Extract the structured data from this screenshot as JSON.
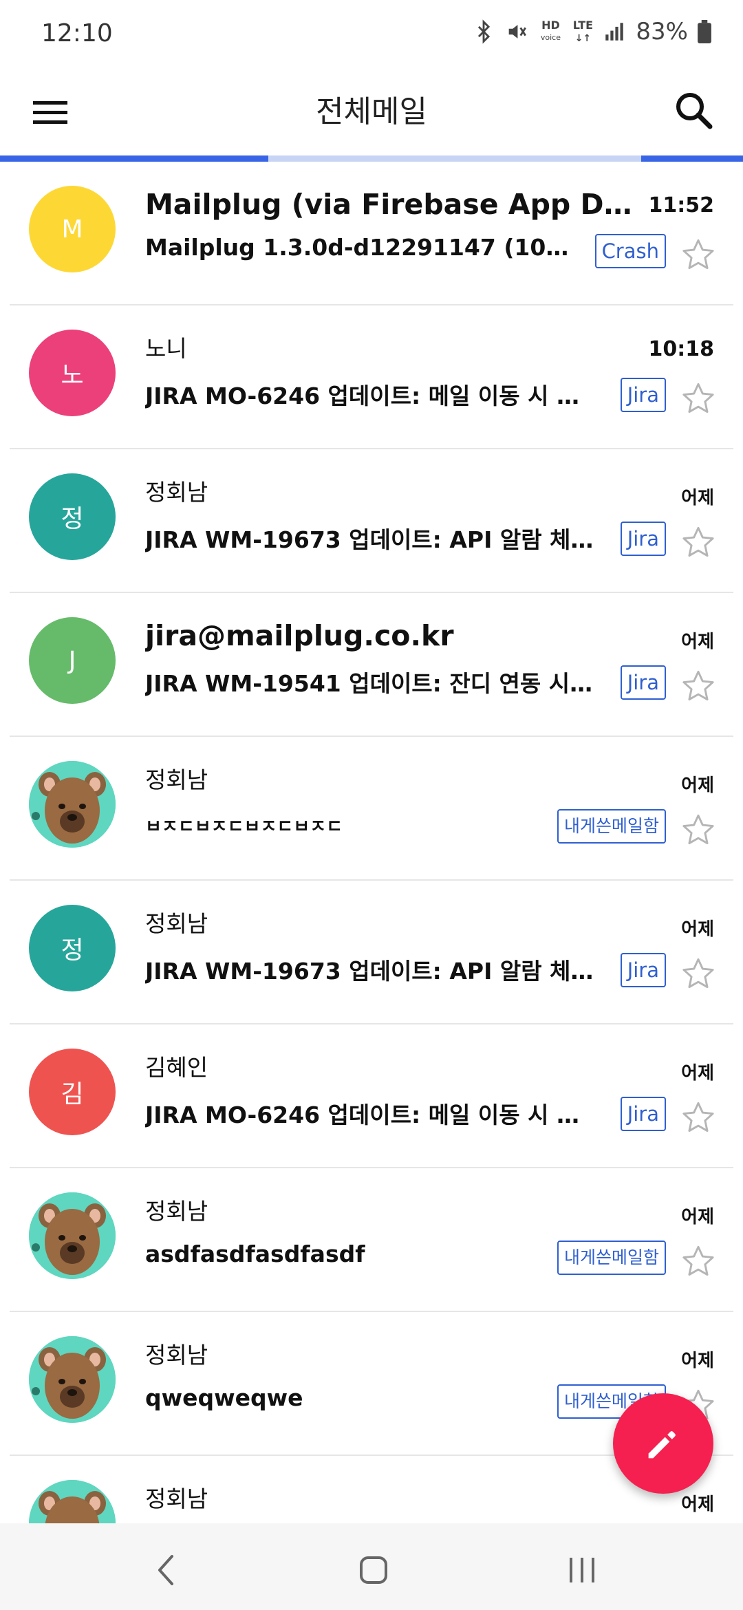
{
  "status_bar": {
    "time": "12:10",
    "battery": "83%",
    "icons": [
      "bluetooth-icon",
      "mute-icon",
      "hd-voice-icon",
      "lte-icon",
      "signal-icon",
      "battery-icon"
    ],
    "hd_label": "HD",
    "lte_label": "LTE"
  },
  "app_bar": {
    "title": "전체메일",
    "menu_icon": "hamburger-menu-icon",
    "search_icon": "search-icon"
  },
  "colors": {
    "accent": "#3864e6",
    "fab": "#f5204f",
    "tag_border": "#2f5fd0"
  },
  "mails": [
    {
      "sender": "Mailplug (via Firebase App Distri...",
      "time": "11:52",
      "subject": "Mailplug 1.3.0d-d12291147 (1030...",
      "label": "Crash",
      "avatar_text": "M",
      "avatar_color": "#fdd835",
      "starred": false
    },
    {
      "sender": "노니",
      "time": "10:18",
      "subject": "JIRA MO-6246 업데이트: 메일 이동 시 내게 ...",
      "label": "Jira",
      "avatar_text": "노",
      "avatar_color": "#ec407a",
      "starred": false
    },
    {
      "sender": "정회남",
      "time": "어제",
      "subject": "JIRA WM-19673 업데이트: API 알람 체크 요청",
      "label": "Jira",
      "avatar_text": "정",
      "avatar_color": "#26a69a",
      "starred": false
    },
    {
      "sender": "jira@mailplug.co.kr",
      "time": "어제",
      "subject": "JIRA WM-19541 업데이트: 잔디 연동 시 웹메...",
      "label": "Jira",
      "avatar_text": "J",
      "avatar_color": "#66bb6a",
      "starred": false
    },
    {
      "sender": "정회남",
      "time": "어제",
      "subject": "ㅂㅈㄷㅂㅈㄷㅂㅈㄷㅂㅈㄷ",
      "label": "내게쓴메일함",
      "avatar_text": "",
      "avatar_color": "#5fd6bf",
      "starred": false
    },
    {
      "sender": "정회남",
      "time": "어제",
      "subject": "JIRA WM-19673 업데이트: API 알람 체크 요청",
      "label": "Jira",
      "avatar_text": "정",
      "avatar_color": "#26a69a",
      "starred": false
    },
    {
      "sender": "김혜인",
      "time": "어제",
      "subject": "JIRA MO-6246 업데이트: 메일 이동 시 내게 ...",
      "label": "Jira",
      "avatar_text": "김",
      "avatar_color": "#ef5350",
      "starred": false
    },
    {
      "sender": "정회남",
      "time": "어제",
      "subject": "asdfasdfasdfasdf",
      "label": "내게쓴메일함",
      "avatar_text": "",
      "avatar_color": "#5fd6bf",
      "starred": false
    },
    {
      "sender": "정회남",
      "time": "어제",
      "subject": "qweqweqwe",
      "label": "내게쓴메일함",
      "avatar_text": "",
      "avatar_color": "#5fd6bf",
      "starred": false
    },
    {
      "sender": "정회남",
      "time": "어제",
      "subject": "",
      "label": "",
      "avatar_text": "",
      "avatar_color": "#5fd6bf",
      "starred": false
    }
  ],
  "fab": {
    "icon": "pencil-compose-icon"
  },
  "nav_bar": {
    "icons": [
      "back-icon",
      "home-icon",
      "recents-icon"
    ]
  }
}
